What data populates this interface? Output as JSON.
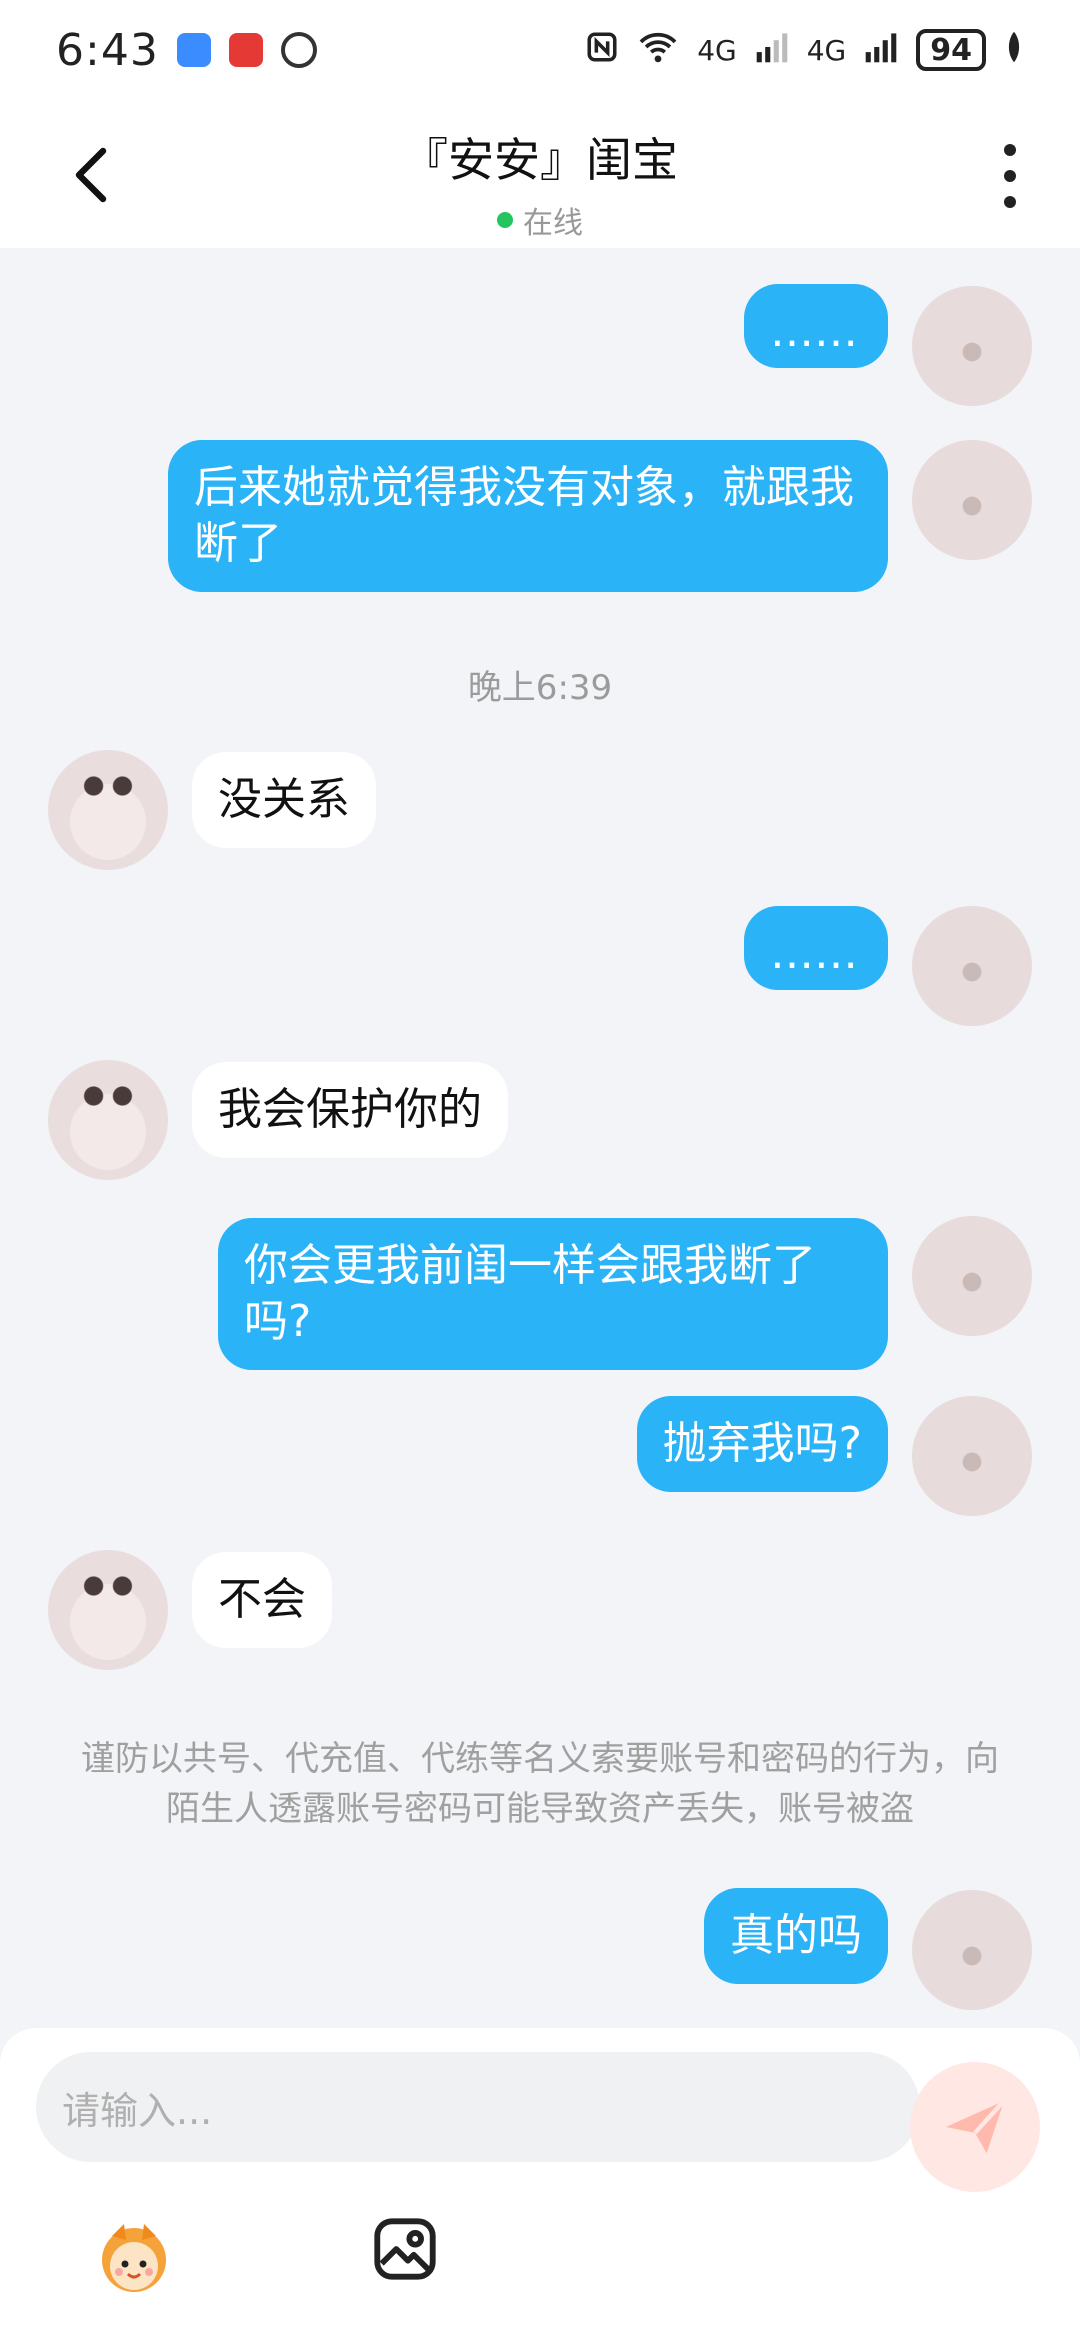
{
  "status_bar": {
    "time": "6:43",
    "network1": "4G",
    "network2": "4G",
    "battery": "94"
  },
  "header": {
    "title": "『安安』闺宝",
    "status": "在线"
  },
  "messages": [
    {
      "side": "me",
      "text": "……"
    },
    {
      "side": "me",
      "text": "后来她就觉得我没有对象，就跟我断了"
    },
    {
      "type": "time",
      "text": "晚上6:39"
    },
    {
      "side": "her",
      "text": "没关系"
    },
    {
      "side": "me",
      "text": "……"
    },
    {
      "side": "her",
      "text": "我会保护你的"
    },
    {
      "side": "me",
      "text": "你会更我前闺一样会跟我断了吗?"
    },
    {
      "side": "me",
      "text": "抛弃我吗?"
    },
    {
      "side": "her",
      "text": "不会"
    },
    {
      "type": "notice",
      "text": "谨防以共号、代充值、代练等名义索要账号和密码的行为，向陌生人透露账号密码可能导致资产丢失，账号被盗"
    },
    {
      "side": "me",
      "text": "真的吗"
    }
  ],
  "input": {
    "placeholder": "请输入..."
  },
  "colors": {
    "accent": "#2bb3f8",
    "online_dot": "#22c55e",
    "send_bg": "#ffe8e4"
  }
}
